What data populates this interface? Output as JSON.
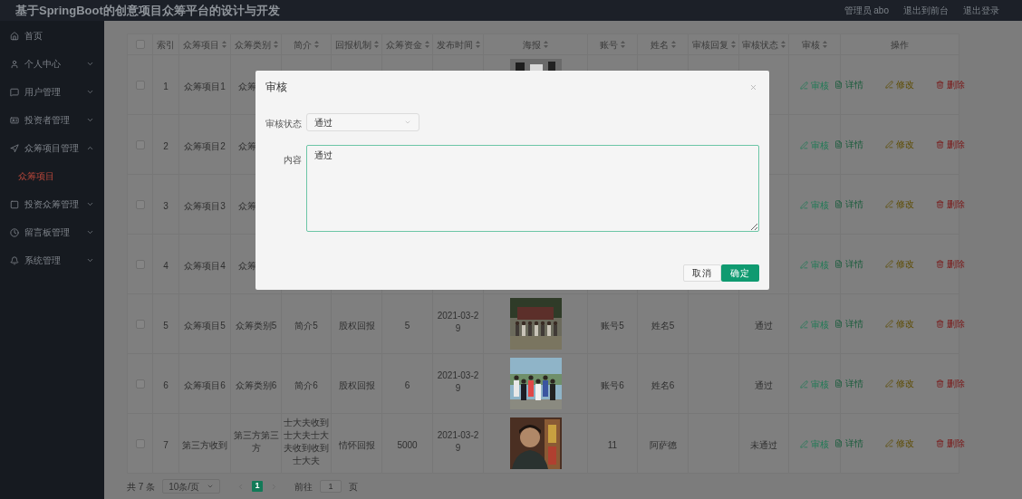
{
  "header": {
    "title": "基于SpringBoot的创意项目众筹平台的设计与开发",
    "links": [
      "管理员 abo",
      "退出到前台",
      "退出登录"
    ]
  },
  "sidebar": {
    "items": [
      {
        "label": "首页",
        "kind": "link"
      },
      {
        "label": "个人中心",
        "kind": "group",
        "expanded": false
      },
      {
        "label": "用户管理",
        "kind": "group",
        "expanded": false
      },
      {
        "label": "投资者管理",
        "kind": "group",
        "expanded": false
      },
      {
        "label": "众筹项目管理",
        "kind": "group",
        "expanded": true,
        "children": [
          {
            "label": "众筹项目",
            "selected": true
          }
        ]
      },
      {
        "label": "投资众筹管理",
        "kind": "group",
        "expanded": false
      },
      {
        "label": "留言板管理",
        "kind": "group",
        "expanded": false
      },
      {
        "label": "系统管理",
        "kind": "group",
        "expanded": false
      }
    ]
  },
  "table": {
    "header_checked": false,
    "columns": [
      {
        "label": "索引",
        "sortable": false
      },
      {
        "label": "众筹项目",
        "sortable": true
      },
      {
        "label": "众筹类别",
        "sortable": true
      },
      {
        "label": "简介",
        "sortable": true
      },
      {
        "label": "回报机制",
        "sortable": true
      },
      {
        "label": "众筹资金",
        "sortable": true
      },
      {
        "label": "发布时间",
        "sortable": true
      },
      {
        "label": "海报",
        "sortable": true
      },
      {
        "label": "账号",
        "sortable": true
      },
      {
        "label": "姓名",
        "sortable": true
      },
      {
        "label": "审核回复",
        "sortable": true
      },
      {
        "label": "审核状态",
        "sortable": true
      },
      {
        "label": "审核",
        "sortable": true
      },
      {
        "label": "操作",
        "sortable": false
      }
    ],
    "rows": [
      {
        "checked": false,
        "covered": true,
        "index": "1",
        "project": "众筹项目1",
        "category": "众筹",
        "review": "审核",
        "actions": [
          {
            "label": "详情",
            "kind": "detail"
          },
          {
            "label": "修改",
            "kind": "edit"
          },
          {
            "label": "删除",
            "kind": "delete"
          }
        ]
      },
      {
        "checked": false,
        "covered": true,
        "index": "2",
        "project": "众筹项目2",
        "category": "众筹",
        "review": "审核",
        "actions": [
          {
            "label": "详情",
            "kind": "detail"
          },
          {
            "label": "修改",
            "kind": "edit"
          },
          {
            "label": "删除",
            "kind": "delete"
          }
        ]
      },
      {
        "checked": false,
        "covered": true,
        "index": "3",
        "project": "众筹项目3",
        "category": "众筹",
        "review": "审核",
        "actions": [
          {
            "label": "详情",
            "kind": "detail"
          },
          {
            "label": "修改",
            "kind": "edit"
          },
          {
            "label": "删除",
            "kind": "delete"
          }
        ]
      },
      {
        "checked": false,
        "covered": true,
        "index": "4",
        "project": "众筹项目4",
        "category": "众筹",
        "review": "审核",
        "actions": [
          {
            "label": "详情",
            "kind": "detail"
          },
          {
            "label": "修改",
            "kind": "edit"
          },
          {
            "label": "删除",
            "kind": "delete"
          }
        ]
      },
      {
        "checked": false,
        "covered": false,
        "index": "5",
        "project": "众筹项目5",
        "category": "众筹类别5",
        "summary": "简介5",
        "reward": "股权回报",
        "funds": "5",
        "date": "2021-03-29",
        "account": "账号5",
        "name": "姓名5",
        "status": "通过",
        "review": "审核",
        "actions": [
          {
            "label": "详情",
            "kind": "detail"
          },
          {
            "label": "修改",
            "kind": "edit"
          },
          {
            "label": "删除",
            "kind": "delete"
          }
        ]
      },
      {
        "checked": false,
        "covered": false,
        "index": "6",
        "project": "众筹项目6",
        "category": "众筹类别6",
        "summary": "简介6",
        "reward": "股权回报",
        "funds": "6",
        "date": "2021-03-29",
        "account": "账号6",
        "name": "姓名6",
        "status": "通过",
        "review": "审核",
        "actions": [
          {
            "label": "详情",
            "kind": "detail"
          },
          {
            "label": "修改",
            "kind": "edit"
          },
          {
            "label": "删除",
            "kind": "delete"
          }
        ]
      },
      {
        "checked": false,
        "covered": false,
        "index": "7",
        "project": "第三方收到",
        "category": "第三方第三方",
        "summary": "士大夫收到士大夫士大夫收到收到士大夫",
        "reward": "情怀回报",
        "funds": "5000",
        "date": "2021-03-29",
        "account": "11",
        "name": "阿萨德",
        "status": "未通过",
        "review": "审核",
        "actions": [
          {
            "label": "详情",
            "kind": "detail"
          },
          {
            "label": "修改",
            "kind": "edit"
          },
          {
            "label": "删除",
            "kind": "delete"
          }
        ]
      }
    ]
  },
  "pagination": {
    "total": "共 7 条",
    "page_size": "10条/页",
    "pages": [
      {
        "label": "1",
        "selected": true
      }
    ],
    "goto_label": "前往",
    "goto_value": "1",
    "goto_suffix": "页"
  },
  "modal": {
    "title": "审核",
    "fields": [
      {
        "kind": "select",
        "label": "审核状态",
        "value": "通过"
      },
      {
        "kind": "textarea",
        "label": "内容",
        "value": "通过"
      }
    ],
    "buttons": [
      {
        "label": "取消",
        "kind": "secondary"
      },
      {
        "label": "确定",
        "kind": "primary"
      }
    ]
  }
}
